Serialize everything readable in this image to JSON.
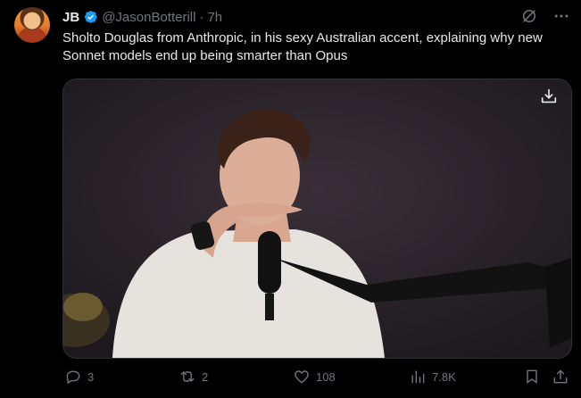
{
  "author": {
    "name": "JB",
    "handle": "@JasonBotterill",
    "separator": "·",
    "time": "7h"
  },
  "tweet": {
    "text": "Sholto Douglas from Anthropic, in his sexy Australian accent, explaining why new Sonnet models end up being smarter than Opus"
  },
  "metrics": {
    "replies": "3",
    "reposts": "2",
    "likes": "108",
    "views": "7.8K"
  },
  "colors": {
    "background": "#000000",
    "text": "#e7e9ea",
    "muted": "#71767b",
    "verified": "#1d9bf0"
  }
}
